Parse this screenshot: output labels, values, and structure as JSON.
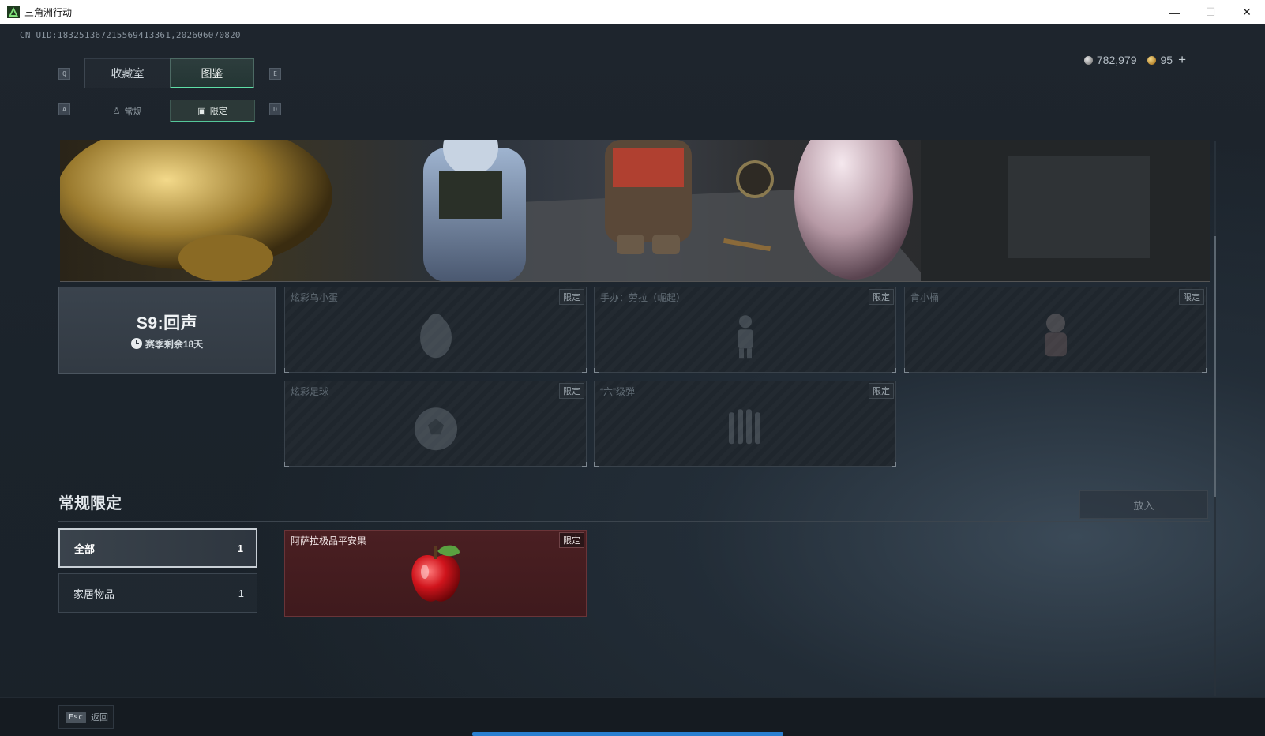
{
  "window": {
    "title": "三角洲行动",
    "minimize": "—",
    "maximize": "☐",
    "close": "✕"
  },
  "uid": "CN UID:1832513672155694133​61,202606070820",
  "currency": {
    "silver": "782,979",
    "gold": "95",
    "plus": "+"
  },
  "keys": {
    "q": "Q",
    "e": "E",
    "a": "A",
    "d": "D",
    "esc": "Esc"
  },
  "tabs": {
    "main": [
      {
        "label": "收藏室"
      },
      {
        "label": "图鉴"
      }
    ],
    "sub": [
      {
        "label": "常规"
      },
      {
        "label": "限定"
      }
    ]
  },
  "season": {
    "title": "S9:回声",
    "remaining": "赛季剩余18天"
  },
  "items": [
    {
      "name": "炫彩乌小蛋",
      "tag": "限定"
    },
    {
      "name": "手办：劳拉（崛起）",
      "tag": "限定"
    },
    {
      "name": "肯小桶",
      "tag": "限定"
    },
    {
      "name": "炫彩足球",
      "tag": "限定"
    },
    {
      "name": "“六”级弹",
      "tag": "限定"
    }
  ],
  "section": {
    "title": "常规限定",
    "put_button": "放入"
  },
  "categories": [
    {
      "label": "全部",
      "count": "1"
    },
    {
      "label": "家居物品",
      "count": "1"
    }
  ],
  "featured_item": {
    "name": "阿萨拉极品平安果",
    "tag": "限定"
  },
  "bottom": {
    "back_label": "返回"
  },
  "colors": {
    "accent": "#5ee0a7",
    "progress": "#2a7fd0",
    "featured_bg": "#4a1f22"
  }
}
